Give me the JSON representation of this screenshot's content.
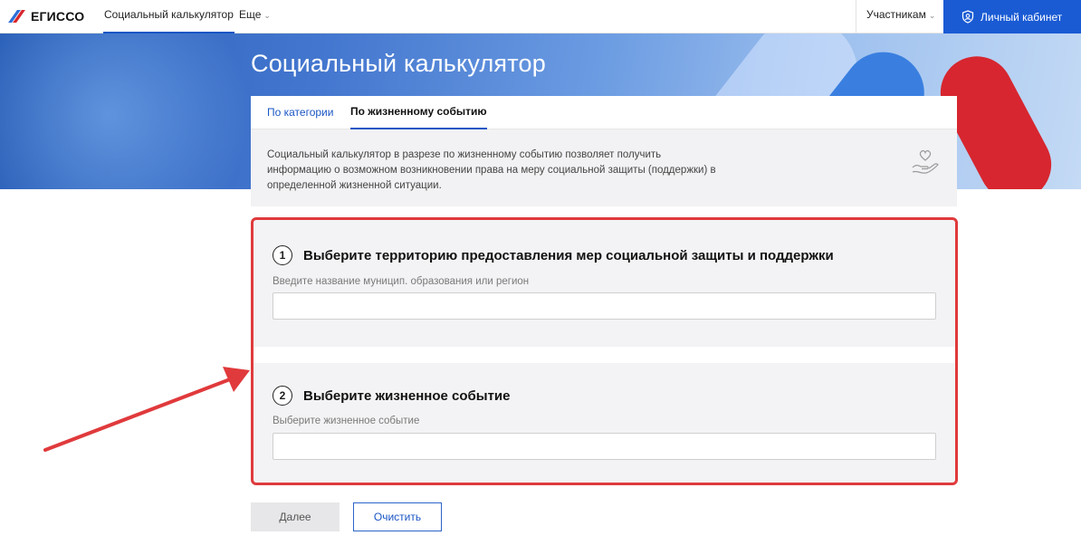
{
  "header": {
    "logo_text": "ЕГИССО",
    "nav": [
      {
        "label": "Социальный калькулятор"
      },
      {
        "label": "Еще"
      }
    ],
    "participants_label": "Участникам",
    "cabinet_label": "Личный кабинет"
  },
  "hero": {
    "title": "Социальный калькулятор"
  },
  "tabs": [
    {
      "label": "По категории"
    },
    {
      "label": "По жизненному событию"
    }
  ],
  "active_tab": "По жизненному событию",
  "info": {
    "text": "Социальный калькулятор в разрезе по жизненному событию позволяет получить информацию о возможном возникновении права на меру социальной защиты (поддержки) в определенной жизненной ситуации."
  },
  "form": {
    "step1": {
      "number": "1",
      "title": "Выберите территорию предоставления мер социальной защиты и поддержки",
      "label": "Введите название муницип. образования или регион",
      "value": ""
    },
    "step2": {
      "number": "2",
      "title": "Выберите жизненное событие",
      "label": "Выберите жизненное событие",
      "value": ""
    }
  },
  "buttons": {
    "next_label": "Далее",
    "clear_label": "Очистить"
  },
  "colors": {
    "accent": "#1a56c4",
    "cabinet_bg": "#1a5bd4",
    "annotation": "#e03a3c"
  },
  "icons": [
    "chevron-down-icon",
    "shield-user-icon",
    "heart-hand-icon"
  ]
}
